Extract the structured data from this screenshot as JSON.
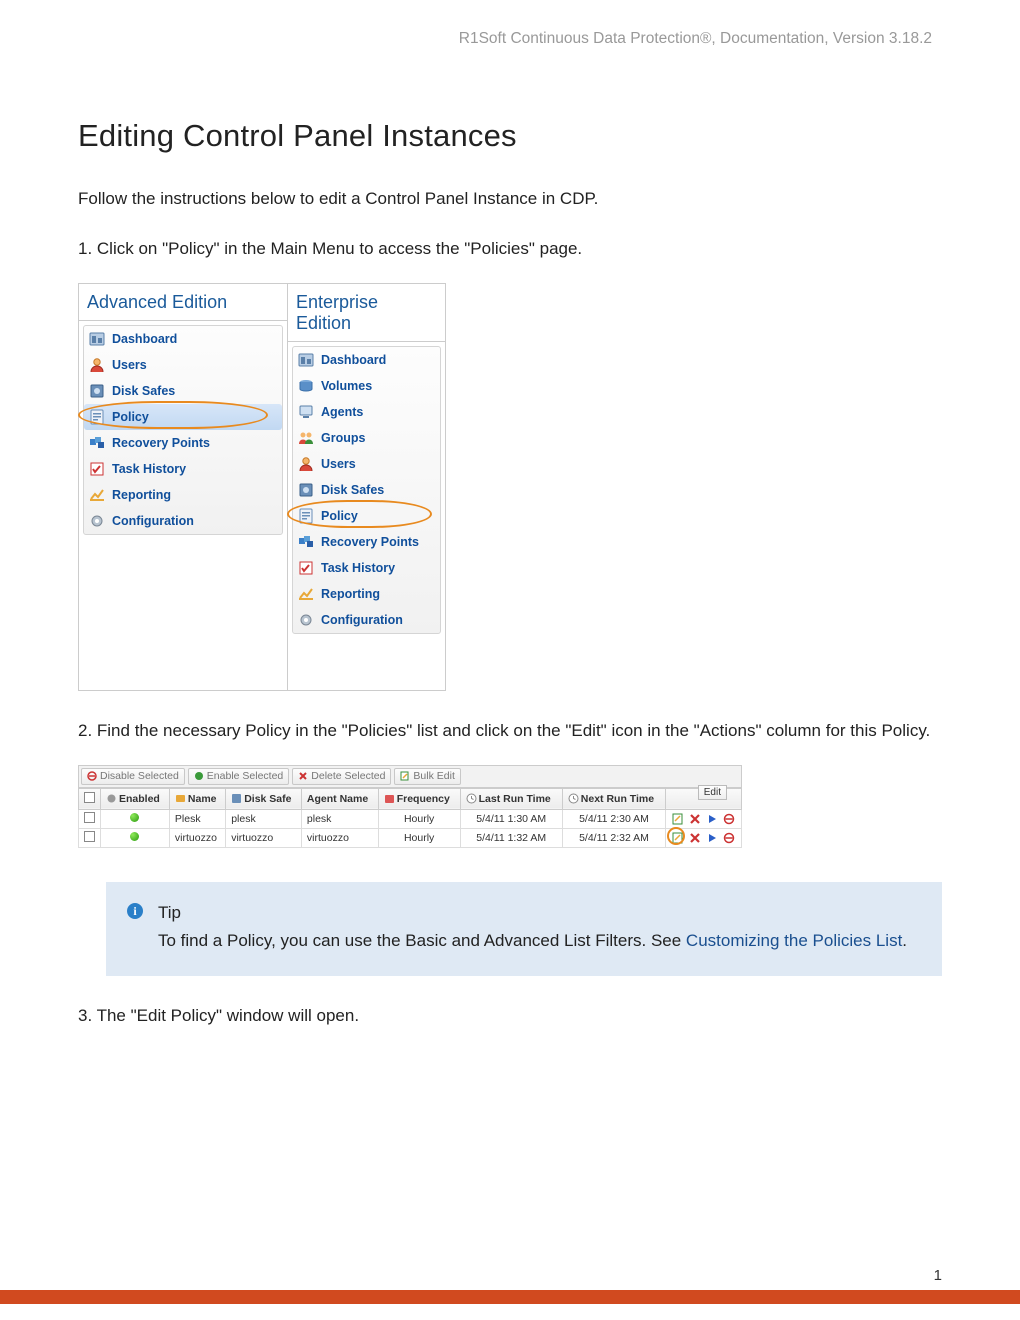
{
  "header": "R1Soft Continuous Data Protection®, Documentation, Version 3.18.2",
  "title": "Editing Control Panel Instances",
  "intro": "Follow the instructions below to edit a Control Panel Instance in CDP.",
  "step1": "1. Click on \"Policy\" in the Main Menu to access the \"Policies\" page.",
  "step2": "2. Find the necessary Policy in the \"Policies\" list and click on the \"Edit\" icon in the \"Actions\" column for this Policy.",
  "step3": "3. The \"Edit Policy\" window will open.",
  "editions": {
    "advanced_label": "Advanced Edition",
    "enterprise_label": "Enterprise Edition",
    "advanced_items": [
      "Dashboard",
      "Users",
      "Disk Safes",
      "Policy",
      "Recovery Points",
      "Task History",
      "Reporting",
      "Configuration"
    ],
    "enterprise_items": [
      "Dashboard",
      "Volumes",
      "Agents",
      "Groups",
      "Users",
      "Disk Safes",
      "Policy",
      "Recovery Points",
      "Task History",
      "Reporting",
      "Configuration"
    ]
  },
  "toolbar": {
    "disable": "Disable Selected",
    "enable": "Enable Selected",
    "delete": "Delete Selected",
    "bulk": "Bulk Edit"
  },
  "table": {
    "cols": [
      "",
      "Enabled",
      "Name",
      "Disk Safe",
      "Agent Name",
      "Frequency",
      "Last Run Time",
      "Next Run Time",
      ""
    ],
    "rows": [
      {
        "name": "Plesk",
        "disksafe": "plesk",
        "agent": "plesk",
        "freq": "Hourly",
        "last": "5/4/11 1:30 AM",
        "next": "5/4/11 2:30 AM"
      },
      {
        "name": "virtuozzo",
        "disksafe": "virtuozzo",
        "agent": "virtuozzo",
        "freq": "Hourly",
        "last": "5/4/11 1:32 AM",
        "next": "5/4/11 2:32 AM"
      }
    ],
    "edit_tooltip": "Edit"
  },
  "tip": {
    "title": "Tip",
    "body_before": "To find a Policy, you can use the Basic and Advanced List Filters. See ",
    "link": "Customizing the Policies List",
    "body_after": "."
  },
  "page_number": "1"
}
